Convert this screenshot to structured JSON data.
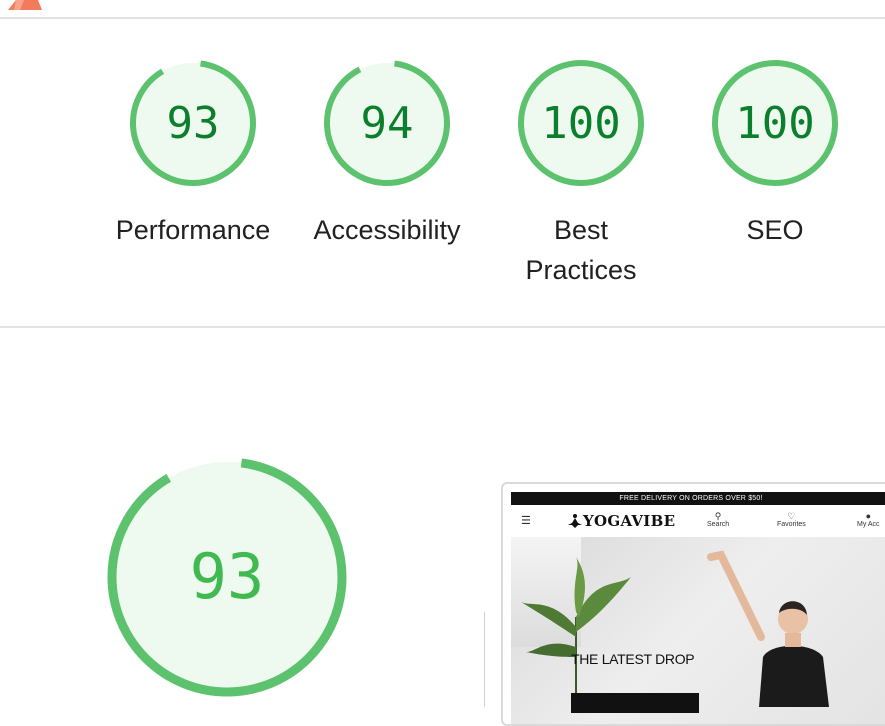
{
  "colors": {
    "pass_ring": "#5cc26e",
    "pass_fill": "#eefaf0",
    "pass_text": "#0b7f2c",
    "big_text": "#3fb950",
    "divider": "#e3e3e3"
  },
  "gauges": [
    {
      "score": "93",
      "label": "Performance",
      "value": 0.93
    },
    {
      "score": "94",
      "label": "Accessibility",
      "value": 0.94
    },
    {
      "score": "100",
      "label": "Best Practices",
      "value": 1.0
    },
    {
      "score": "100",
      "label": "SEO",
      "value": 1.0
    }
  ],
  "main_gauge": {
    "score": "93",
    "value": 0.93
  },
  "screenshot": {
    "promo": "FREE DELIVERY ON ORDERS OVER $50!",
    "brand": "YOGAVIBE",
    "nav": [
      {
        "label": "Search",
        "icon": "search-icon"
      },
      {
        "label": "Favorites",
        "icon": "heart-icon"
      },
      {
        "label": "My Acc",
        "icon": "user-icon"
      }
    ],
    "hero_title": "THE LATEST DROP"
  }
}
